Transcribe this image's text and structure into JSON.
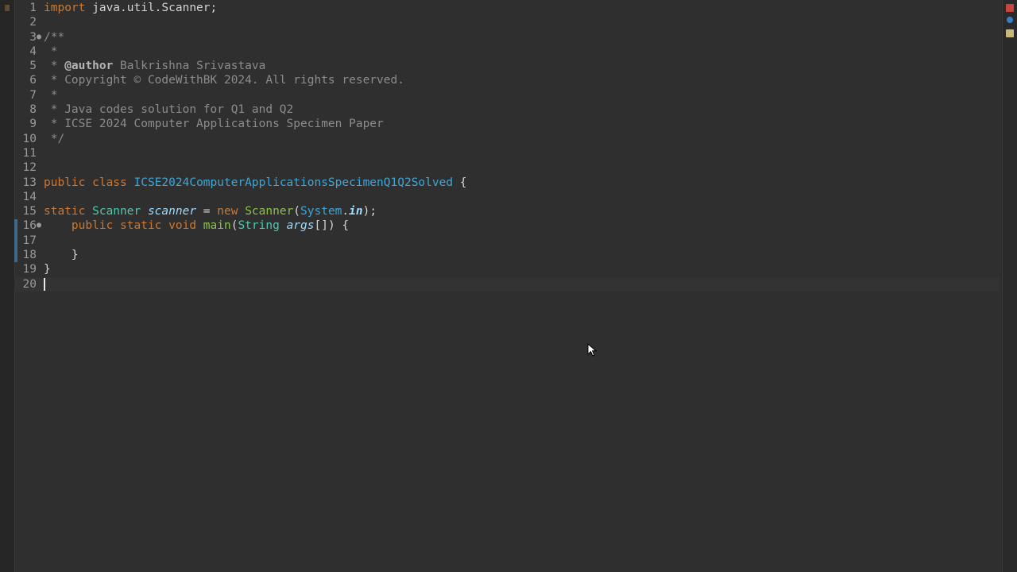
{
  "editor": {
    "lines": [
      {
        "n": "1",
        "fold": "",
        "tokens": [
          [
            "kw",
            "import "
          ],
          [
            "plain",
            "java.util.Scanner;"
          ]
        ]
      },
      {
        "n": "2",
        "fold": "",
        "tokens": []
      },
      {
        "n": "3",
        "fold": "●",
        "tokens": [
          [
            "cmt",
            "/**"
          ]
        ]
      },
      {
        "n": "4",
        "fold": "",
        "tokens": [
          [
            "cmt",
            " *"
          ]
        ]
      },
      {
        "n": "5",
        "fold": "",
        "tokens": [
          [
            "cmt",
            " * "
          ],
          [
            "tag",
            "@author"
          ],
          [
            "cmt",
            " Balkrishna Srivastava"
          ]
        ]
      },
      {
        "n": "6",
        "fold": "",
        "tokens": [
          [
            "cmt",
            " * Copyright © CodeWithBK 2024. All rights reserved."
          ]
        ]
      },
      {
        "n": "7",
        "fold": "",
        "tokens": [
          [
            "cmt",
            " *"
          ]
        ]
      },
      {
        "n": "8",
        "fold": "",
        "tokens": [
          [
            "cmt",
            " * Java codes solution for Q1 and Q2"
          ]
        ]
      },
      {
        "n": "9",
        "fold": "",
        "tokens": [
          [
            "cmt",
            " * ICSE 2024 Computer Applications Specimen Paper"
          ]
        ]
      },
      {
        "n": "10",
        "fold": "",
        "tokens": [
          [
            "cmt",
            " */"
          ]
        ]
      },
      {
        "n": "11",
        "fold": "",
        "tokens": []
      },
      {
        "n": "12",
        "fold": "",
        "tokens": []
      },
      {
        "n": "13",
        "fold": "",
        "tokens": [
          [
            "kw",
            "public class "
          ],
          [
            "cls",
            "ICSE2024ComputerApplicationsSpecimenQ1Q2Solved"
          ],
          [
            "plain",
            " {"
          ]
        ]
      },
      {
        "n": "14",
        "fold": "",
        "tokens": []
      },
      {
        "n": "15",
        "fold": "",
        "tokens": [
          [
            "kw",
            "static "
          ],
          [
            "typ",
            "Scanner "
          ],
          [
            "var",
            "scanner"
          ],
          [
            "plain",
            " = "
          ],
          [
            "kw",
            "new "
          ],
          [
            "fn",
            "Scanner"
          ],
          [
            "plain",
            "("
          ],
          [
            "sysfld",
            "System"
          ],
          [
            "plain",
            "."
          ],
          [
            "fld",
            "in"
          ],
          [
            "plain",
            ");"
          ]
        ]
      },
      {
        "n": "16",
        "fold": "●",
        "tokens": [
          [
            "plain",
            "    "
          ],
          [
            "kw",
            "public static void "
          ],
          [
            "fn",
            "main"
          ],
          [
            "plain",
            "("
          ],
          [
            "typ",
            "String "
          ],
          [
            "var",
            "args"
          ],
          [
            "plain",
            "[]) {"
          ]
        ]
      },
      {
        "n": "17",
        "fold": "",
        "tokens": []
      },
      {
        "n": "18",
        "fold": "",
        "tokens": [
          [
            "plain",
            "    }"
          ]
        ]
      },
      {
        "n": "19",
        "fold": "",
        "tokens": [
          [
            "plain",
            "}"
          ]
        ]
      },
      {
        "n": "20",
        "fold": "",
        "tokens": [],
        "caret": true,
        "current": true
      }
    ]
  },
  "colors": {
    "keyword": "#cc7832",
    "comment": "#8c8c8c",
    "class": "#3fa6d6",
    "function": "#8bc34a",
    "variable": "#9cdcfe"
  },
  "icons": {
    "left_strip": "bookmark-icon",
    "ruler": [
      "error-marker-icon",
      "info-marker-icon",
      "task-marker-icon"
    ],
    "pointer": "mouse-pointer-icon"
  }
}
